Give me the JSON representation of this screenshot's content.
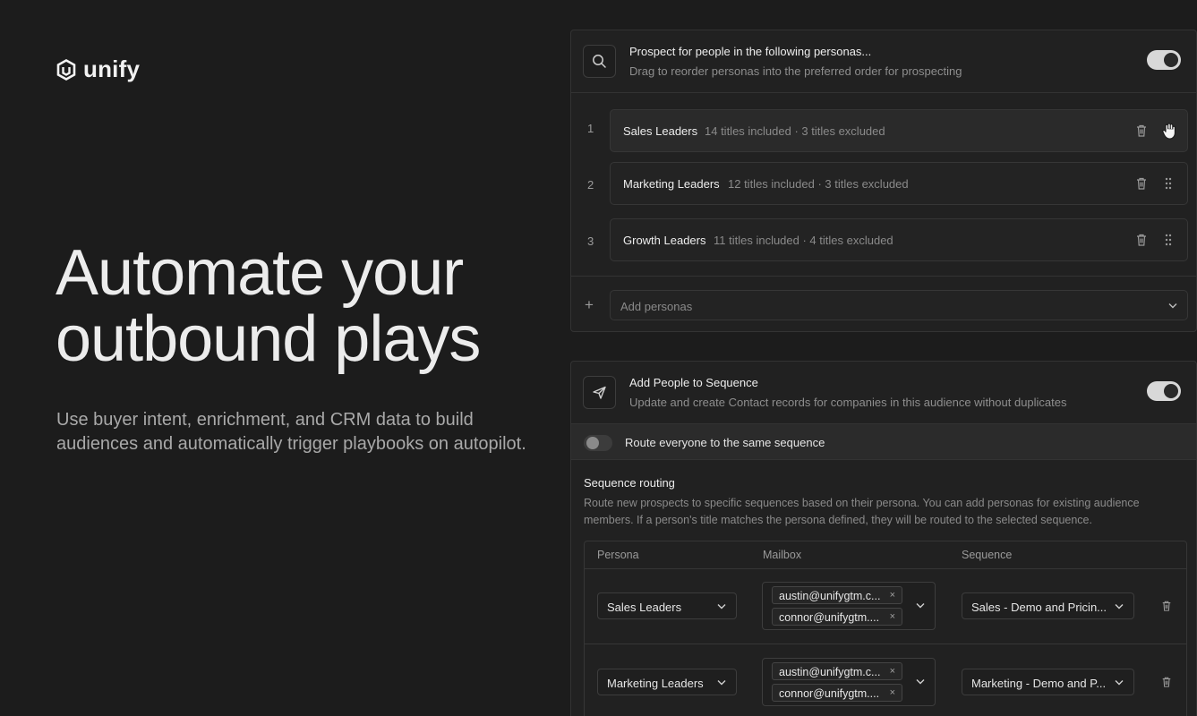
{
  "brand": {
    "name": "unify"
  },
  "hero": {
    "title_line1": "Automate your",
    "title_line2": "outbound plays",
    "subtitle": "Use buyer intent, enrichment, and CRM data to build audiences and automatically trigger playbooks on autopilot."
  },
  "prospect_card": {
    "title": "Prospect for people in the following personas...",
    "subtitle": "Drag to reorder personas into the preferred order for prospecting",
    "enabled": true,
    "personas": [
      {
        "num": "1",
        "name": "Sales Leaders",
        "meta": "14 titles included · 3 titles excluded"
      },
      {
        "num": "2",
        "name": "Marketing Leaders",
        "meta": "12 titles included · 3 titles excluded"
      },
      {
        "num": "3",
        "name": "Growth Leaders",
        "meta": "11 titles included · 4 titles excluded"
      }
    ],
    "add_plus": "+",
    "add_placeholder": "Add personas"
  },
  "sequence_card": {
    "title": "Add People to Sequence",
    "subtitle": "Update and create Contact records for companies in this audience without duplicates",
    "enabled": true,
    "route_all_label": "Route everyone to the same sequence",
    "route_all_enabled": false,
    "routing_title": "Sequence routing",
    "routing_desc": "Route new prospects to specific sequences based on their persona. You can add personas for existing audience members. If a person's title matches the persona defined, they will be routed to the selected sequence.",
    "columns": [
      "Persona",
      "Mailbox",
      "Sequence"
    ],
    "rows": [
      {
        "persona": "Sales Leaders",
        "mailboxes": [
          "austin@unifygtm.c...",
          "connor@unifygtm...."
        ],
        "sequence": "Sales - Demo and Pricin..."
      },
      {
        "persona": "Marketing Leaders",
        "mailboxes": [
          "austin@unifygtm.c...",
          "connor@unifygtm...."
        ],
        "sequence": "Marketing - Demo and P..."
      }
    ],
    "chip_remove": "×"
  },
  "icons": [
    "logo-icon",
    "search-icon",
    "send-icon",
    "trash-icon",
    "drag-handle-icon",
    "grab-cursor-icon",
    "chevron-down-icon"
  ]
}
